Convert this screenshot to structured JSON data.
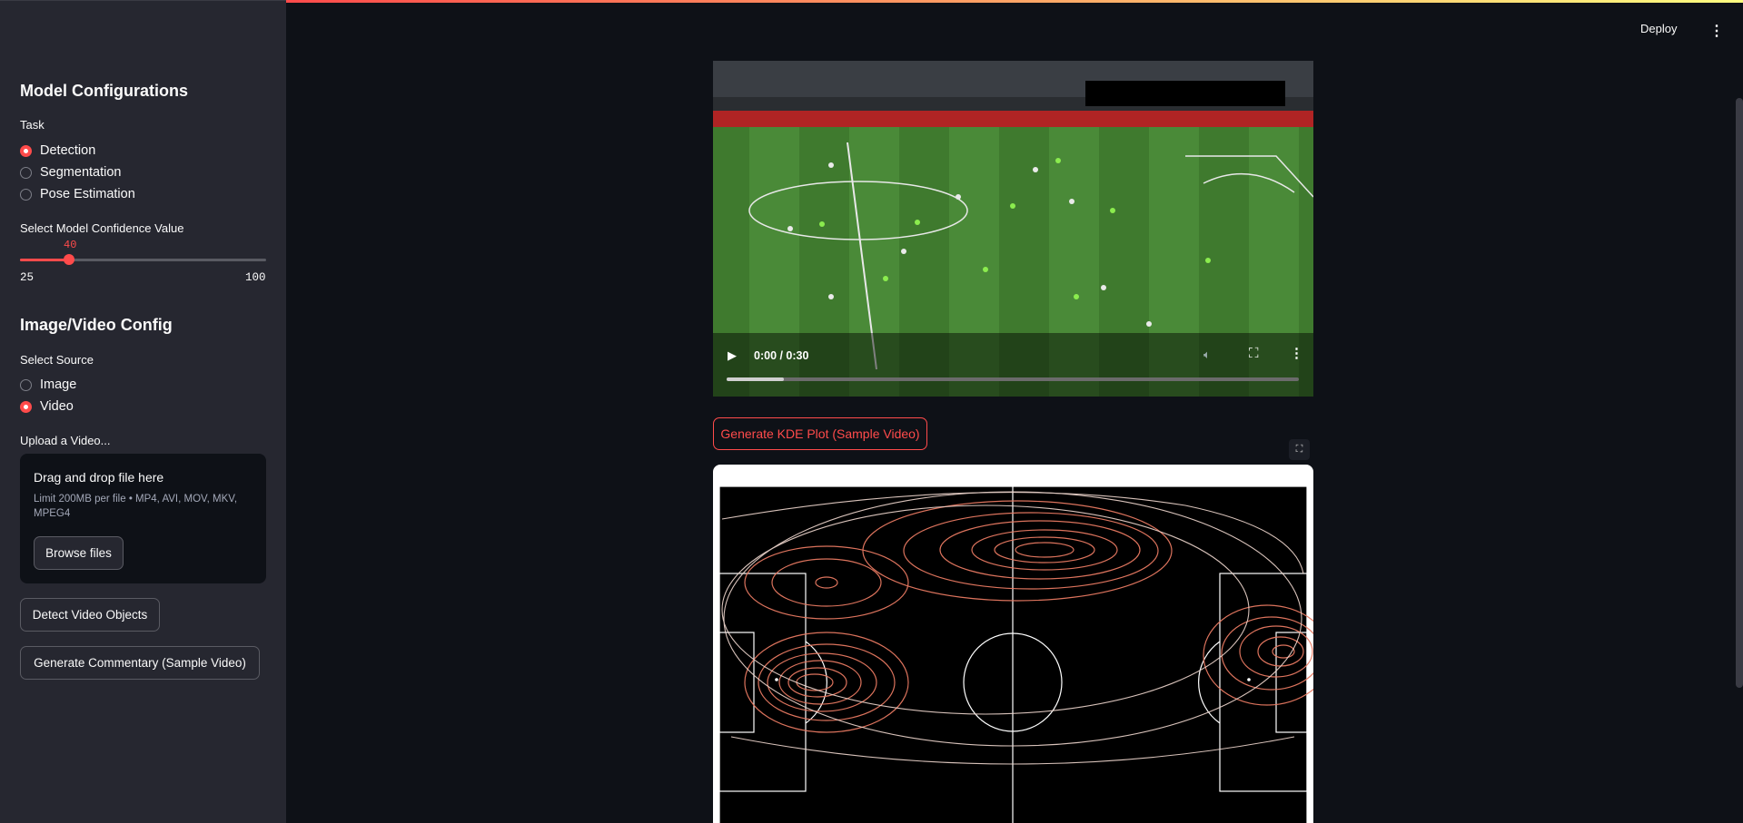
{
  "header": {
    "deploy_label": "Deploy",
    "menu_icon": "kebab-icon"
  },
  "sidebar": {
    "model_config_title": "Model Configurations",
    "task_label": "Task",
    "task_options": [
      "Detection",
      "Segmentation",
      "Pose Estimation"
    ],
    "task_selected": "Detection",
    "confidence_label": "Select Model Confidence Value",
    "confidence": {
      "value": "40",
      "min": "25",
      "max": "100"
    },
    "source_title": "Image/Video Config",
    "source_label": "Select Source",
    "source_options": [
      "Image",
      "Video"
    ],
    "source_selected": "Video",
    "upload_label": "Upload a Video...",
    "dropzone": {
      "title": "Drag and drop file here",
      "limits": "Limit 200MB per file • MP4, AVI, MOV, MKV, MPEG4",
      "browse_label": "Browse files"
    },
    "detect_button": "Detect Video Objects",
    "commentary_button": "Generate Commentary (Sample Video)"
  },
  "main": {
    "video": {
      "time": "0:00 / 0:30",
      "progress": 0.1
    },
    "kde_button": "Generate KDE Plot (Sample Video)",
    "expand_icon": "expand-icon"
  },
  "colors": {
    "accent": "#ff4b4b",
    "background": "#0e1117",
    "sidebar": "#262730"
  }
}
